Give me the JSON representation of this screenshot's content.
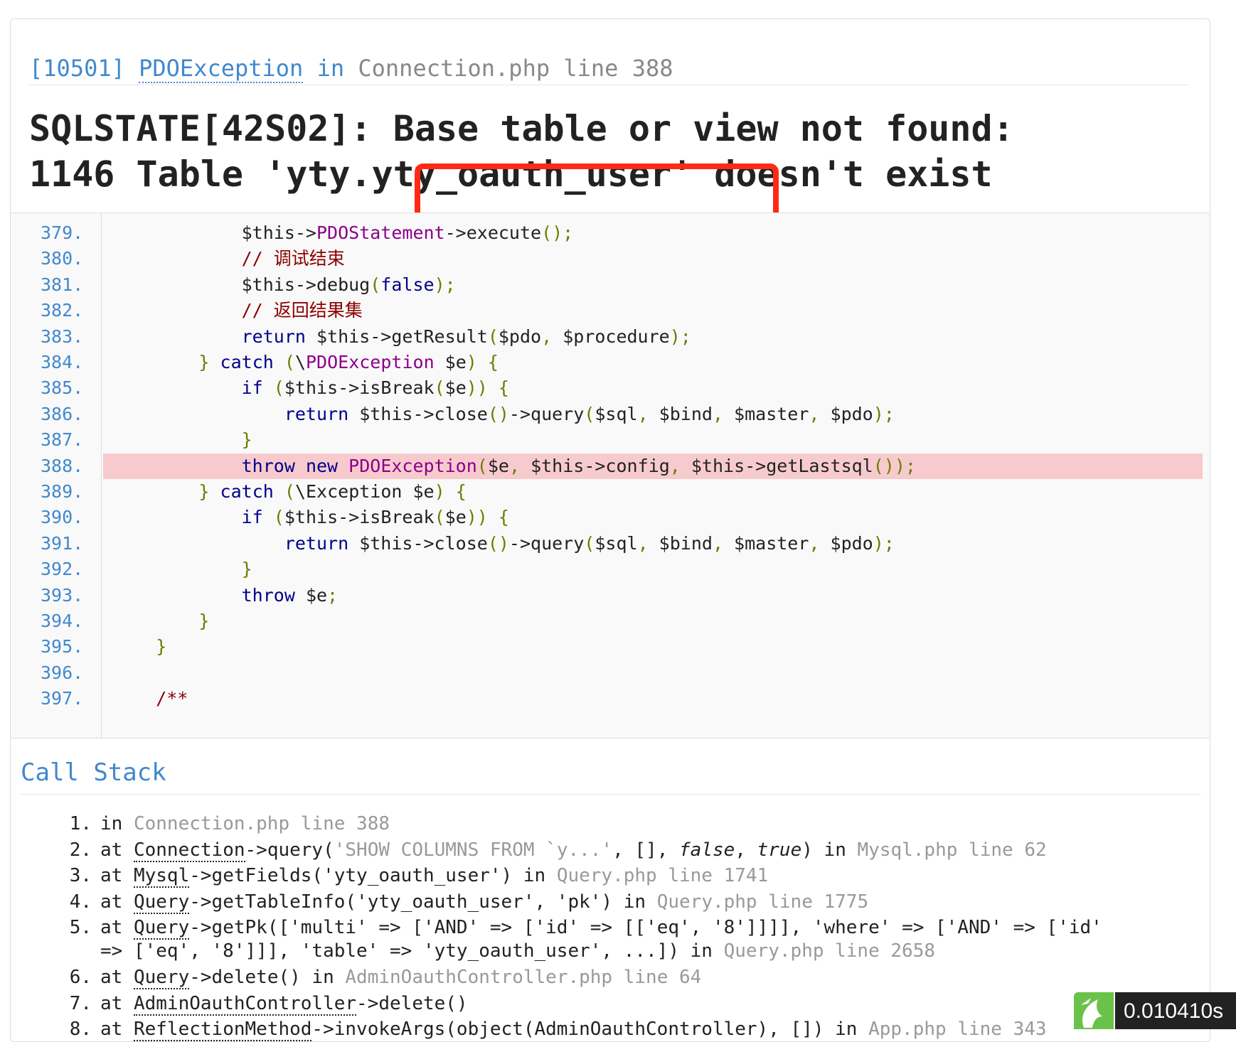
{
  "header": {
    "error_code": "[10501]",
    "exception_class": "PDOException",
    "in_word": "in",
    "location": "Connection.php line 388"
  },
  "message": {
    "line1": "SQLSTATE[42S02]: Base table or view not found:",
    "line2": "1146 Table 'yty.yty_oauth_user' doesn't exist"
  },
  "source": {
    "highlight_line": "388.",
    "lines": [
      {
        "num": "379.",
        "code": [
          {
            "t": "            $this->",
            "c": ""
          },
          {
            "t": "PDOStatement",
            "c": "cl"
          },
          {
            "t": "->execute",
            "c": ""
          },
          {
            "t": "();",
            "c": "pn"
          }
        ]
      },
      {
        "num": "380.",
        "code": [
          {
            "t": "            // 调试结束",
            "c": "cm"
          }
        ]
      },
      {
        "num": "381.",
        "code": [
          {
            "t": "            $this->debug",
            "c": ""
          },
          {
            "t": "(",
            "c": "pn"
          },
          {
            "t": "false",
            "c": "kw"
          },
          {
            "t": ");",
            "c": "pn"
          }
        ]
      },
      {
        "num": "382.",
        "code": [
          {
            "t": "            // 返回结果集",
            "c": "cm"
          }
        ]
      },
      {
        "num": "383.",
        "code": [
          {
            "t": "            ",
            "c": ""
          },
          {
            "t": "return",
            "c": "kw"
          },
          {
            "t": " $this->getResult",
            "c": ""
          },
          {
            "t": "(",
            "c": "pn"
          },
          {
            "t": "$pdo",
            "c": ""
          },
          {
            "t": ", ",
            "c": "pn"
          },
          {
            "t": "$procedure",
            "c": ""
          },
          {
            "t": ");",
            "c": "pn"
          }
        ]
      },
      {
        "num": "384.",
        "code": [
          {
            "t": "        ",
            "c": ""
          },
          {
            "t": "}",
            "c": "pn"
          },
          {
            "t": " ",
            "c": ""
          },
          {
            "t": "catch",
            "c": "kw"
          },
          {
            "t": " ",
            "c": ""
          },
          {
            "t": "(",
            "c": "pn"
          },
          {
            "t": "\\",
            "c": ""
          },
          {
            "t": "PDOException",
            "c": "cl"
          },
          {
            "t": " $e",
            "c": ""
          },
          {
            "t": ") {",
            "c": "pn"
          }
        ]
      },
      {
        "num": "385.",
        "code": [
          {
            "t": "            ",
            "c": ""
          },
          {
            "t": "if",
            "c": "kw"
          },
          {
            "t": " ",
            "c": ""
          },
          {
            "t": "(",
            "c": "pn"
          },
          {
            "t": "$this->isBreak",
            "c": ""
          },
          {
            "t": "(",
            "c": "pn"
          },
          {
            "t": "$e",
            "c": ""
          },
          {
            "t": ")) {",
            "c": "pn"
          }
        ]
      },
      {
        "num": "386.",
        "code": [
          {
            "t": "                ",
            "c": ""
          },
          {
            "t": "return",
            "c": "kw"
          },
          {
            "t": " $this->close",
            "c": ""
          },
          {
            "t": "()",
            "c": "pn"
          },
          {
            "t": "->query",
            "c": ""
          },
          {
            "t": "(",
            "c": "pn"
          },
          {
            "t": "$sql",
            "c": ""
          },
          {
            "t": ", ",
            "c": "pn"
          },
          {
            "t": "$bind",
            "c": ""
          },
          {
            "t": ", ",
            "c": "pn"
          },
          {
            "t": "$master",
            "c": ""
          },
          {
            "t": ", ",
            "c": "pn"
          },
          {
            "t": "$pdo",
            "c": ""
          },
          {
            "t": ");",
            "c": "pn"
          }
        ]
      },
      {
        "num": "387.",
        "code": [
          {
            "t": "            ",
            "c": ""
          },
          {
            "t": "}",
            "c": "pn"
          }
        ]
      },
      {
        "num": "388.",
        "code": [
          {
            "t": "            ",
            "c": ""
          },
          {
            "t": "throw",
            "c": "kw"
          },
          {
            "t": " ",
            "c": ""
          },
          {
            "t": "new",
            "c": "kw"
          },
          {
            "t": " ",
            "c": ""
          },
          {
            "t": "PDOException",
            "c": "cl"
          },
          {
            "t": "(",
            "c": "pn"
          },
          {
            "t": "$e",
            "c": ""
          },
          {
            "t": ", ",
            "c": "pn"
          },
          {
            "t": "$this->config",
            "c": ""
          },
          {
            "t": ", ",
            "c": "pn"
          },
          {
            "t": "$this->getLastsql",
            "c": ""
          },
          {
            "t": "());",
            "c": "pn"
          }
        ]
      },
      {
        "num": "389.",
        "code": [
          {
            "t": "        ",
            "c": ""
          },
          {
            "t": "}",
            "c": "pn"
          },
          {
            "t": " ",
            "c": ""
          },
          {
            "t": "catch",
            "c": "kw"
          },
          {
            "t": " ",
            "c": ""
          },
          {
            "t": "(",
            "c": "pn"
          },
          {
            "t": "\\Exception $e",
            "c": ""
          },
          {
            "t": ") {",
            "c": "pn"
          }
        ]
      },
      {
        "num": "390.",
        "code": [
          {
            "t": "            ",
            "c": ""
          },
          {
            "t": "if",
            "c": "kw"
          },
          {
            "t": " ",
            "c": ""
          },
          {
            "t": "(",
            "c": "pn"
          },
          {
            "t": "$this->isBreak",
            "c": ""
          },
          {
            "t": "(",
            "c": "pn"
          },
          {
            "t": "$e",
            "c": ""
          },
          {
            "t": ")) {",
            "c": "pn"
          }
        ]
      },
      {
        "num": "391.",
        "code": [
          {
            "t": "                ",
            "c": ""
          },
          {
            "t": "return",
            "c": "kw"
          },
          {
            "t": " $this->close",
            "c": ""
          },
          {
            "t": "()",
            "c": "pn"
          },
          {
            "t": "->query",
            "c": ""
          },
          {
            "t": "(",
            "c": "pn"
          },
          {
            "t": "$sql",
            "c": ""
          },
          {
            "t": ", ",
            "c": "pn"
          },
          {
            "t": "$bind",
            "c": ""
          },
          {
            "t": ", ",
            "c": "pn"
          },
          {
            "t": "$master",
            "c": ""
          },
          {
            "t": ", ",
            "c": "pn"
          },
          {
            "t": "$pdo",
            "c": ""
          },
          {
            "t": ");",
            "c": "pn"
          }
        ]
      },
      {
        "num": "392.",
        "code": [
          {
            "t": "            ",
            "c": ""
          },
          {
            "t": "}",
            "c": "pn"
          }
        ]
      },
      {
        "num": "393.",
        "code": [
          {
            "t": "            ",
            "c": ""
          },
          {
            "t": "throw",
            "c": "kw"
          },
          {
            "t": " $e",
            "c": ""
          },
          {
            "t": ";",
            "c": "pn"
          }
        ]
      },
      {
        "num": "394.",
        "code": [
          {
            "t": "        ",
            "c": ""
          },
          {
            "t": "}",
            "c": "pn"
          }
        ]
      },
      {
        "num": "395.",
        "code": [
          {
            "t": "    ",
            "c": ""
          },
          {
            "t": "}",
            "c": "pn"
          }
        ]
      },
      {
        "num": "396.",
        "code": []
      },
      {
        "num": "397.",
        "code": [
          {
            "t": "    /**",
            "c": "cm"
          }
        ]
      }
    ]
  },
  "call_stack": {
    "title": "Call Stack",
    "items": [
      {
        "num": "1.",
        "lines": [
          [
            {
              "t": "in ",
              "c": ""
            },
            {
              "t": "Connection.php line 388",
              "c": "gray"
            }
          ]
        ]
      },
      {
        "num": "2.",
        "lines": [
          [
            {
              "t": "at ",
              "c": ""
            },
            {
              "t": "Connection",
              "c": "cls"
            },
            {
              "t": "->query(",
              "c": ""
            },
            {
              "t": "'SHOW COLUMNS FROM `y...'",
              "c": "gray"
            },
            {
              "t": ", [], ",
              "c": ""
            },
            {
              "t": "false",
              "c": "it"
            },
            {
              "t": ", ",
              "c": ""
            },
            {
              "t": "true",
              "c": "it"
            },
            {
              "t": ") in ",
              "c": ""
            },
            {
              "t": "Mysql.php line 62",
              "c": "gray"
            }
          ]
        ]
      },
      {
        "num": "3.",
        "lines": [
          [
            {
              "t": "at ",
              "c": ""
            },
            {
              "t": "Mysql",
              "c": "cls"
            },
            {
              "t": "->getFields('yty_oauth_user') in ",
              "c": ""
            },
            {
              "t": "Query.php line 1741",
              "c": "gray"
            }
          ]
        ]
      },
      {
        "num": "4.",
        "lines": [
          [
            {
              "t": "at ",
              "c": ""
            },
            {
              "t": "Query",
              "c": "cls"
            },
            {
              "t": "->getTableInfo('yty_oauth_user', 'pk') in ",
              "c": ""
            },
            {
              "t": "Query.php line 1775",
              "c": "gray"
            }
          ]
        ]
      },
      {
        "num": "5.",
        "lines": [
          [
            {
              "t": "at ",
              "c": ""
            },
            {
              "t": "Query",
              "c": "cls"
            },
            {
              "t": "->getPk(['multi' => ['AND' => ['id' => [['eq', '8']]]], 'where' => ['AND' => ['id'",
              "c": ""
            }
          ],
          [
            {
              "t": "=> ['eq', '8']]], 'table' => 'yty_oauth_user', ...]) in ",
              "c": ""
            },
            {
              "t": "Query.php line 2658",
              "c": "gray"
            }
          ]
        ]
      },
      {
        "num": "6.",
        "lines": [
          [
            {
              "t": "at ",
              "c": ""
            },
            {
              "t": "Query",
              "c": "cls"
            },
            {
              "t": "->delete() in ",
              "c": ""
            },
            {
              "t": "AdminOauthController.php line 64",
              "c": "gray"
            }
          ]
        ]
      },
      {
        "num": "7.",
        "lines": [
          [
            {
              "t": "at ",
              "c": ""
            },
            {
              "t": "AdminOauthController",
              "c": "cls"
            },
            {
              "t": "->delete()",
              "c": ""
            }
          ]
        ]
      },
      {
        "num": "8.",
        "lines": [
          [
            {
              "t": "at ",
              "c": ""
            },
            {
              "t": "ReflectionMethod",
              "c": "cls"
            },
            {
              "t": "->invokeArgs(object(AdminOauthController), []) in ",
              "c": ""
            },
            {
              "t": "App.php line 343",
              "c": "gray"
            }
          ]
        ]
      }
    ]
  },
  "runtime": {
    "time": "0.010410s",
    "icon": "thinkphp-logo-icon"
  },
  "colors": {
    "accent": "#4288ce",
    "highlight_row": "#f7cbcd",
    "annotation_box": "#ff2a14",
    "badge_bg": "#222222",
    "badge_logo": "#6bc24a"
  }
}
